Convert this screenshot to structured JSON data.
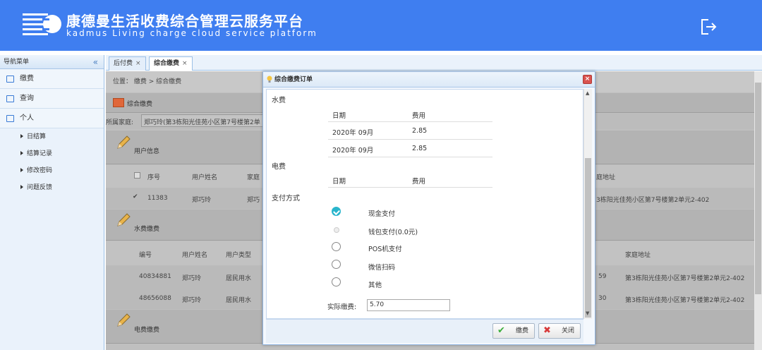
{
  "header": {
    "title_cn": "康德曼生活收费综合管理云服务平台",
    "title_en": "kadmus Living charge cloud service platform"
  },
  "sidebar": {
    "title": "导航菜单",
    "collapse": "«",
    "items": [
      {
        "label": "缴费",
        "icon": "payment-icon"
      },
      {
        "label": "查询",
        "icon": "query-icon"
      },
      {
        "label": "个人",
        "icon": "personal-icon"
      }
    ],
    "sub_items": [
      "日结算",
      "结算记录",
      "修改密码",
      "问题反馈"
    ]
  },
  "tabs": [
    {
      "label": "后付费",
      "close": "×"
    },
    {
      "label": "综合缴费",
      "close": "×"
    }
  ],
  "breadcrumb": "位置：  缴费  >  综合缴费",
  "page": {
    "section_btn": "综合缴费",
    "family_label": "所属家庭:",
    "family_value": "郑巧玲(第3栋阳光佳苑小区第7号楼第2单",
    "user_info": "用户信息",
    "user_table": {
      "headers": [
        "序号",
        "用户姓名",
        "家庭",
        "庭地址"
      ],
      "row": [
        "11383",
        "郑巧玲",
        "郑巧",
        "3栋阳光佳苑小区第7号楼第2单元2-402"
      ]
    },
    "water_section": "水费缴费",
    "water_table": {
      "headers": [
        "编号",
        "用户姓名",
        "用户类型",
        "家庭地址"
      ],
      "rows": [
        [
          "40834881",
          "郑巧玲",
          "居民用水",
          "59",
          "第3栋阳光佳苑小区第7号楼第2单元2-402"
        ],
        [
          "48656088",
          "郑巧玲",
          "居民用水",
          "30",
          "第3栋阳光佳苑小区第7号楼第2单元2-402"
        ]
      ]
    },
    "elec_section": "电费缴费"
  },
  "modal": {
    "title": "综合缴费订单",
    "close": "×",
    "water_title": "水费",
    "water_headers": [
      "日期",
      "费用"
    ],
    "water_rows": [
      [
        "2020年 09月",
        "2.85"
      ],
      [
        "2020年 09月",
        "2.85"
      ]
    ],
    "elec_title": "电费",
    "elec_headers": [
      "日期",
      "费用"
    ],
    "pay_title": "支付方式",
    "pay_options": [
      "现金支付",
      "钱包支付(0.0元)",
      "POS机支付",
      "微信扫码",
      "其他"
    ],
    "amount_label": "实际缴费:",
    "amount_value": "5.70",
    "pay_btn": "缴费",
    "close_btn": "关闭"
  },
  "colors": {
    "header": "#3f7ef0",
    "check": "#29b5cc"
  }
}
